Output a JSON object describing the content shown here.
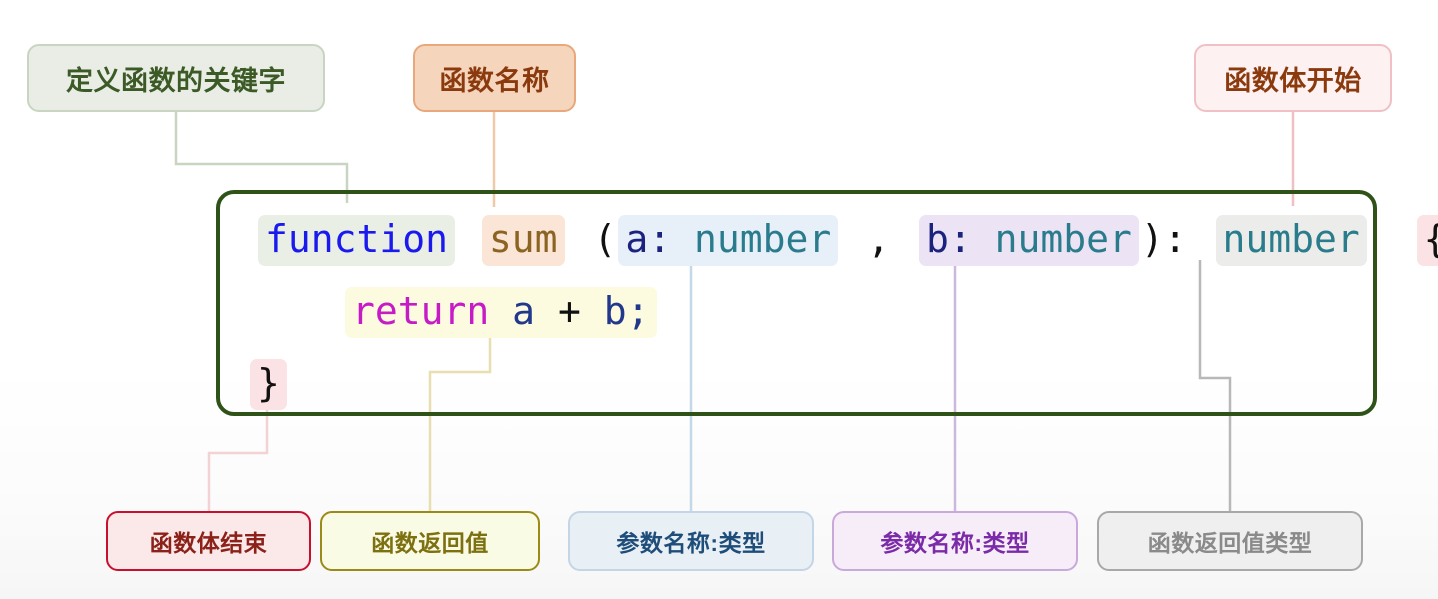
{
  "diagram": {
    "title_hidden": "",
    "code": {
      "line1": {
        "keyword": "function",
        "name": "sum",
        "open_paren": "(",
        "param1_name": "a:",
        "param1_type": "number",
        "comma": ",",
        "param2_name": "b:",
        "param2_type": "number",
        "close_paren": "):",
        "return_type": "number",
        "open_brace": "{"
      },
      "line2": {
        "keyword": "return",
        "expr_a": "a",
        "operator": "+",
        "expr_b": "b;"
      },
      "line3": {
        "close_brace": "}"
      }
    },
    "labels": {
      "keyword": "定义函数的关键字",
      "func_name": "函数名称",
      "body_start": "函数体开始",
      "body_end": "函数体结束",
      "return_value": "函数返回值",
      "param1": "参数名称:类型",
      "param2": "参数名称:类型",
      "return_type": "函数返回值类型"
    },
    "colors": {
      "keyword_border": "#c8d5c0",
      "keyword_bg": "#e9ede6",
      "keyword_text": "#3c5a25",
      "func_name_border": "#e8a87c",
      "func_name_bg": "#f5d5bc",
      "func_name_text": "#8b3a0e",
      "body_start_border": "#f0c0c4",
      "body_start_bg": "#fdf1f1",
      "body_start_text": "#8b3a0e",
      "body_end_border": "#c8102e",
      "body_end_bg": "#fbe8e9",
      "body_end_text": "#8b2118",
      "return_value_border": "#9a8a16",
      "return_value_bg": "#fafbe4",
      "return_value_text": "#7d7010",
      "param1_border": "#c4d5e6",
      "param1_bg": "#e8eff5",
      "param1_text": "#1f4d79",
      "param2_border": "#c9a8dc",
      "param2_bg": "#f6edf8",
      "param2_text": "#7b2aa8",
      "return_type_border": "#a8a8a8",
      "return_type_bg": "#efefef",
      "return_type_text": "#8a8a8a",
      "code_border": "#2f5218"
    }
  }
}
